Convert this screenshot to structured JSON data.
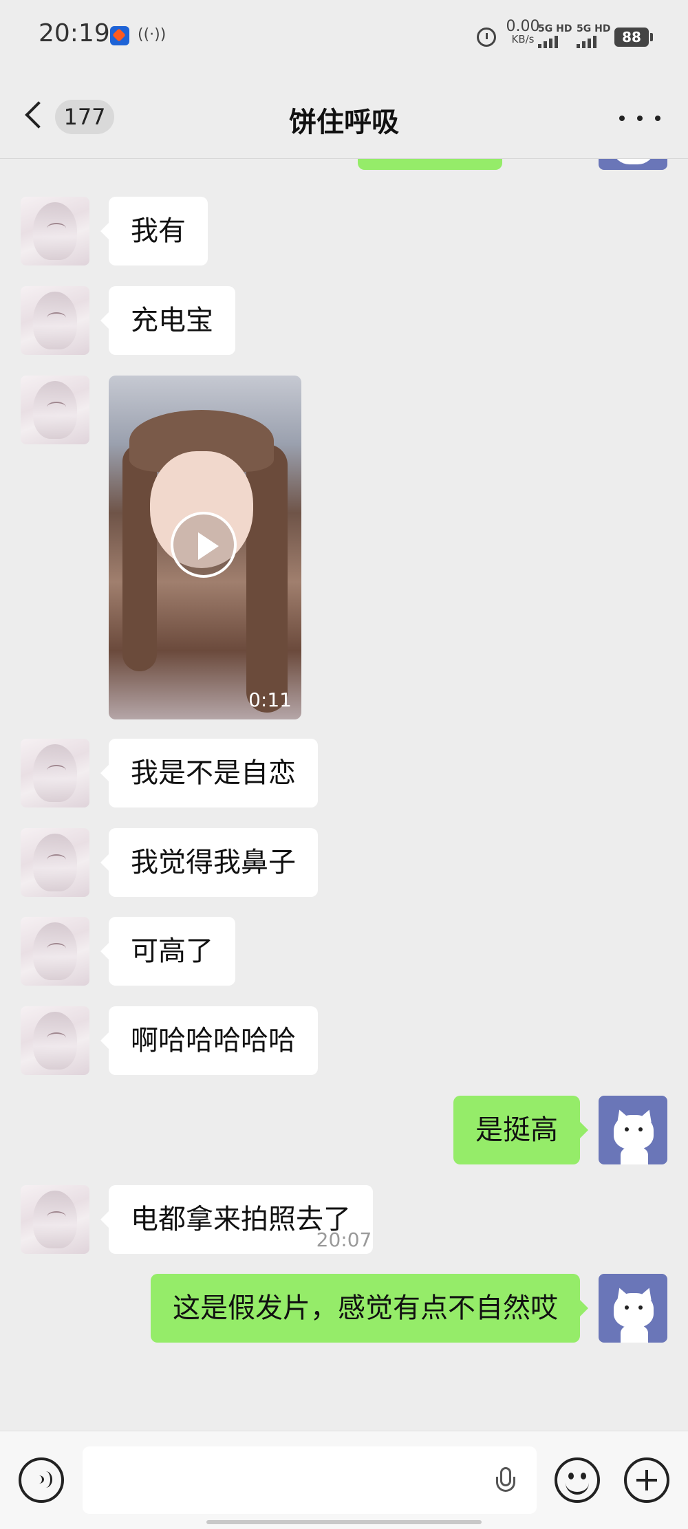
{
  "status_bar": {
    "time": "20:19",
    "hotspot": "((·))",
    "net_speed_value": "0.00",
    "net_speed_unit": "KB/s",
    "sim1_label": "5G HD",
    "sim2_label": "5G HD",
    "battery": "88"
  },
  "header": {
    "back_count": "177",
    "title": "饼住呼吸"
  },
  "messages": [
    {
      "side": "left",
      "type": "text",
      "text": "我有"
    },
    {
      "side": "left",
      "type": "text",
      "text": "充电宝"
    },
    {
      "side": "left",
      "type": "video",
      "duration": "0:11"
    },
    {
      "side": "left",
      "type": "text",
      "text": "我是不是自恋"
    },
    {
      "side": "left",
      "type": "text",
      "text": "我觉得我鼻子"
    },
    {
      "side": "left",
      "type": "text",
      "text": "可高了"
    },
    {
      "side": "left",
      "type": "text",
      "text": "啊哈哈哈哈哈"
    },
    {
      "side": "right",
      "type": "text",
      "text": "是挺高"
    },
    {
      "side": "left",
      "type": "text",
      "text": "电都拿来拍照去了"
    },
    {
      "side": "right",
      "type": "text",
      "text": "这是假发片，感觉有点不自然哎"
    }
  ],
  "timestamp": "20:07",
  "colors": {
    "background": "#ededed",
    "sent_bubble": "#95ec69",
    "received_bubble": "#ffffff"
  }
}
